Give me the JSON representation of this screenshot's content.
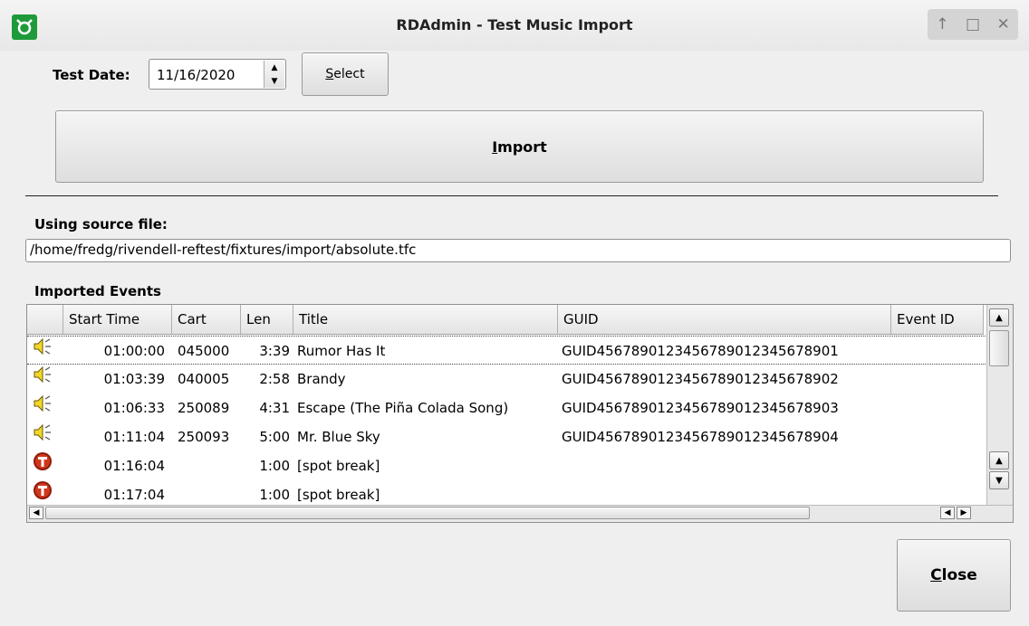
{
  "window": {
    "title": "RDAdmin - Test Music Import",
    "controls": [
      "↑",
      "□",
      "✕"
    ]
  },
  "form": {
    "test_date_label": "Test Date:",
    "test_date_value": "11/16/2020",
    "select_label_u": "S",
    "select_label_rest": "elect",
    "import_label_u": "I",
    "import_label_rest": "mport",
    "source_file_label": "Using source file:",
    "source_file_value": "/home/fredg/rivendell-reftest/fixtures/import/absolute.tfc",
    "events_label": "Imported Events",
    "close_label_u": "C",
    "close_label_rest": "lose"
  },
  "table": {
    "columns": [
      "Start Time",
      "Cart",
      "Len",
      "Title",
      "GUID",
      "Event ID"
    ],
    "rows": [
      {
        "icon": "speaker-icon",
        "start": "01:00:00",
        "cart": "045000",
        "len": "3:39",
        "title": "Rumor Has It",
        "guid": "GUID45678901234567890123456789​01"
      },
      {
        "icon": "speaker-icon",
        "start": "01:03:39",
        "cart": "040005",
        "len": "2:58",
        "title": "Brandy",
        "guid": "GUID4567890123456789012345678902"
      },
      {
        "icon": "speaker-icon",
        "start": "01:06:33",
        "cart": "250089",
        "len": "4:31",
        "title": "Escape (The Piña Colada Song)",
        "guid": "GUID4567890123456789012345678903"
      },
      {
        "icon": "speaker-icon",
        "start": "01:11:04",
        "cart": "250093",
        "len": "5:00",
        "title": "Mr. Blue Sky",
        "guid": "GUID4567890123456789012345678904"
      },
      {
        "icon": "traffic-icon",
        "start": "01:16:04",
        "cart": "",
        "len": "1:00",
        "title": "[spot break]",
        "guid": ""
      },
      {
        "icon": "traffic-icon",
        "start": "01:17:04",
        "cart": "",
        "len": "1:00",
        "title": "[spot break]",
        "guid": ""
      }
    ]
  }
}
